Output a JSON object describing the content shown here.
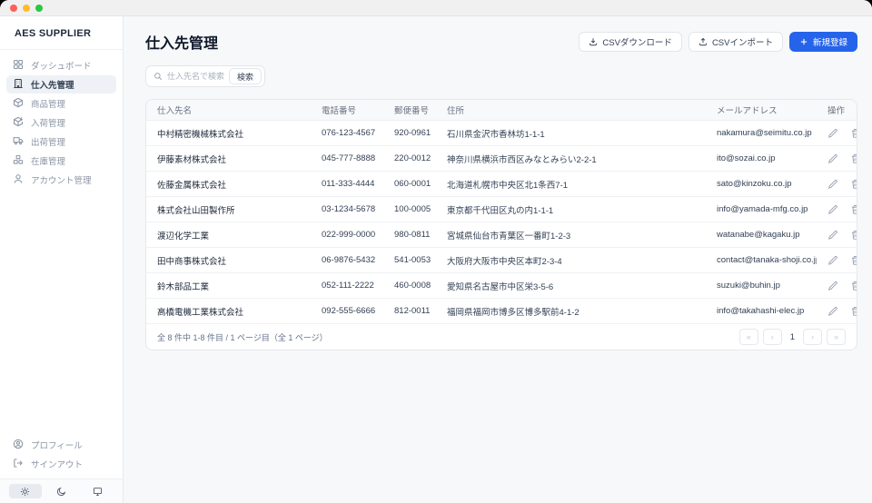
{
  "sidebar": {
    "brand": "AES SUPPLIER",
    "items": [
      {
        "label": "ダッシュボード",
        "icon": "dashboard-icon",
        "active": false
      },
      {
        "label": "仕入先管理",
        "icon": "building-icon",
        "active": true
      },
      {
        "label": "商品管理",
        "icon": "package-icon",
        "active": false
      },
      {
        "label": "入荷管理",
        "icon": "package-in-icon",
        "active": false
      },
      {
        "label": "出荷管理",
        "icon": "truck-icon",
        "active": false
      },
      {
        "label": "在庫管理",
        "icon": "boxes-icon",
        "active": false
      },
      {
        "label": "アカウント管理",
        "icon": "user-icon",
        "active": false
      }
    ],
    "footer_items": [
      {
        "label": "プロフィール",
        "icon": "profile-icon"
      },
      {
        "label": "サインアウト",
        "icon": "signout-icon"
      }
    ],
    "theme_toggle": {
      "options": [
        "light",
        "dark",
        "system"
      ],
      "selected": "light"
    }
  },
  "header": {
    "title": "仕入先管理",
    "csv_download_label": "CSVダウンロード",
    "csv_import_label": "CSVインポート",
    "register_label": "新規登録"
  },
  "search": {
    "placeholder": "仕入先名で検索...",
    "button_label": "検索"
  },
  "table": {
    "columns": [
      "仕入先名",
      "電話番号",
      "郵便番号",
      "住所",
      "メールアドレス",
      "操作"
    ],
    "rows": [
      {
        "name": "中村精密機械株式会社",
        "phone": "076-123-4567",
        "postal": "920-0961",
        "address": "石川県金沢市香林坊1-1-1",
        "email": "nakamura@seimitu.co.jp"
      },
      {
        "name": "伊藤素材株式会社",
        "phone": "045-777-8888",
        "postal": "220-0012",
        "address": "神奈川県横浜市西区みなとみらい2-2-1",
        "email": "ito@sozai.co.jp"
      },
      {
        "name": "佐藤金属株式会社",
        "phone": "011-333-4444",
        "postal": "060-0001",
        "address": "北海道札幌市中央区北1条西7-1",
        "email": "sato@kinzoku.co.jp"
      },
      {
        "name": "株式会社山田製作所",
        "phone": "03-1234-5678",
        "postal": "100-0005",
        "address": "東京都千代田区丸の内1-1-1",
        "email": "info@yamada-mfg.co.jp"
      },
      {
        "name": "渡辺化学工業",
        "phone": "022-999-0000",
        "postal": "980-0811",
        "address": "宮城県仙台市青葉区一番町1-2-3",
        "email": "watanabe@kagaku.jp"
      },
      {
        "name": "田中商事株式会社",
        "phone": "06-9876-5432",
        "postal": "541-0053",
        "address": "大阪府大阪市中央区本町2-3-4",
        "email": "contact@tanaka-shoji.co.jp"
      },
      {
        "name": "鈴木部品工業",
        "phone": "052-111-2222",
        "postal": "460-0008",
        "address": "愛知県名古屋市中区栄3-5-6",
        "email": "suzuki@buhin.jp"
      },
      {
        "name": "高橋電機工業株式会社",
        "phone": "092-555-6666",
        "postal": "812-0011",
        "address": "福岡県福岡市博多区博多駅前4-1-2",
        "email": "info@takahashi-elec.jp"
      }
    ]
  },
  "pagination": {
    "summary": "全 8 件中 1-8 件目 / 1 ページ目（全 1 ページ）",
    "first": "«",
    "prev": "‹",
    "current": "1",
    "next": "›",
    "last": "»"
  },
  "colors": {
    "accent": "#2563eb",
    "active_item_bg": "#eef1f5"
  }
}
